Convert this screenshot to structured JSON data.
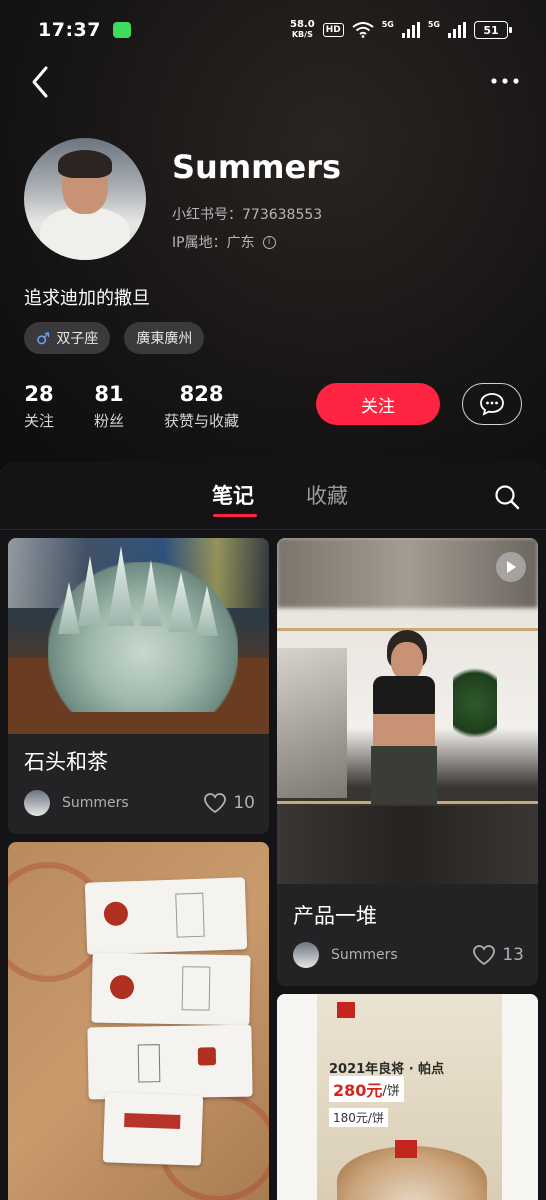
{
  "status_bar": {
    "time": "17:37",
    "net_speed_value": "58.0",
    "net_speed_unit": "KB/S",
    "hd_label": "HD",
    "network_1": "5G",
    "network_2": "5G",
    "battery": "51"
  },
  "profile": {
    "name": "Summers",
    "id_line": "小红书号：773638553",
    "ip_line": "IP属地：广东",
    "info_icon": "i",
    "bio": "追求迪加的撒旦",
    "tags": [
      "双子座",
      "廣東廣州"
    ],
    "gender_symbol": "♂",
    "stats": [
      {
        "value": "28",
        "label": "关注"
      },
      {
        "value": "81",
        "label": "粉丝"
      },
      {
        "value": "828",
        "label": "获赞与收藏"
      }
    ],
    "follow_label": "关注"
  },
  "tabs": {
    "active": "笔记",
    "inactive": "收藏"
  },
  "posts": [
    {
      "title": "石头和茶",
      "author": "Summers",
      "likes": "10"
    },
    {
      "title": "产品一堆",
      "author": "Summers",
      "likes": "13"
    }
  ],
  "poster": {
    "line1": "2021年良将 · 帕点",
    "price1": "280元",
    "price1_unit": "/饼",
    "price2": "180元/饼"
  },
  "colors": {
    "accent": "#ff2442",
    "background": "#141416",
    "card": "#232325"
  }
}
